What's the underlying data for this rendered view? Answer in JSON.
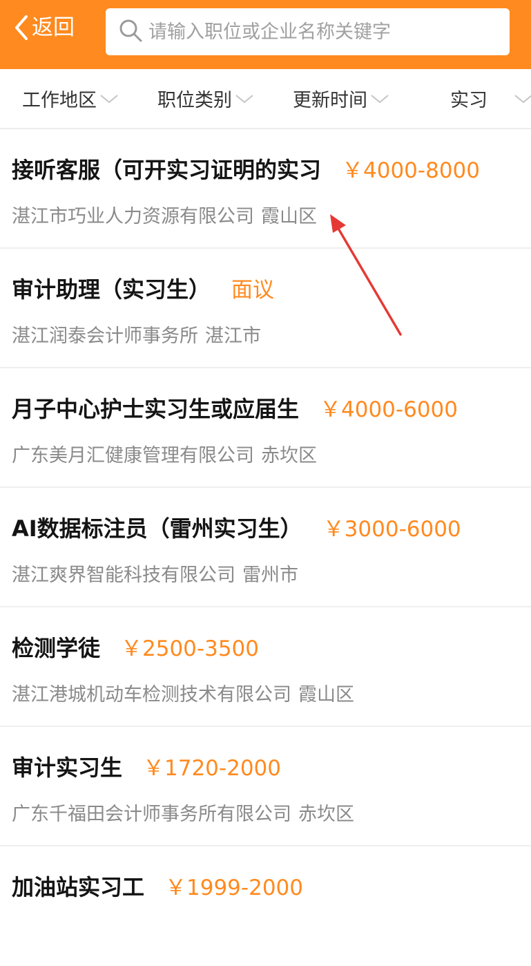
{
  "header": {
    "back_label": "返回",
    "search_placeholder": "请输入职位或企业名称关键字",
    "search_value": ""
  },
  "filters": [
    {
      "label": "工作地区"
    },
    {
      "label": "职位类别"
    },
    {
      "label": "更新时间"
    },
    {
      "label": "实习"
    }
  ],
  "jobs": [
    {
      "title": "接听客服（可开实习证明的实习",
      "salary": "￥4000-8000",
      "company": "湛江市巧业人力资源有限公司",
      "location": "霞山区"
    },
    {
      "title": "审计助理（实习生）",
      "salary": "面议",
      "company": "湛江润泰会计师事务所",
      "location": "湛江市"
    },
    {
      "title": "月子中心护士实习生或应届生",
      "salary": "￥4000-6000",
      "company": "广东美月汇健康管理有限公司",
      "location": "赤坎区"
    },
    {
      "title": "AI数据标注员（雷州实习生）",
      "salary": "￥3000-6000",
      "company": "湛江爽界智能科技有限公司",
      "location": "雷州市"
    },
    {
      "title": "检测学徒",
      "salary": "￥2500-3500",
      "company": "湛江港城机动车检测技术有限公司",
      "location": "霞山区"
    },
    {
      "title": "审计实习生",
      "salary": "￥1720-2000",
      "company": "广东千福田会计师事务所有限公司",
      "location": "赤坎区"
    },
    {
      "title": "加油站实习工",
      "salary": "￥1999-2000",
      "company": "",
      "location": ""
    }
  ],
  "colors": {
    "brand": "#ff8a1f",
    "annotation": "#e53935"
  }
}
